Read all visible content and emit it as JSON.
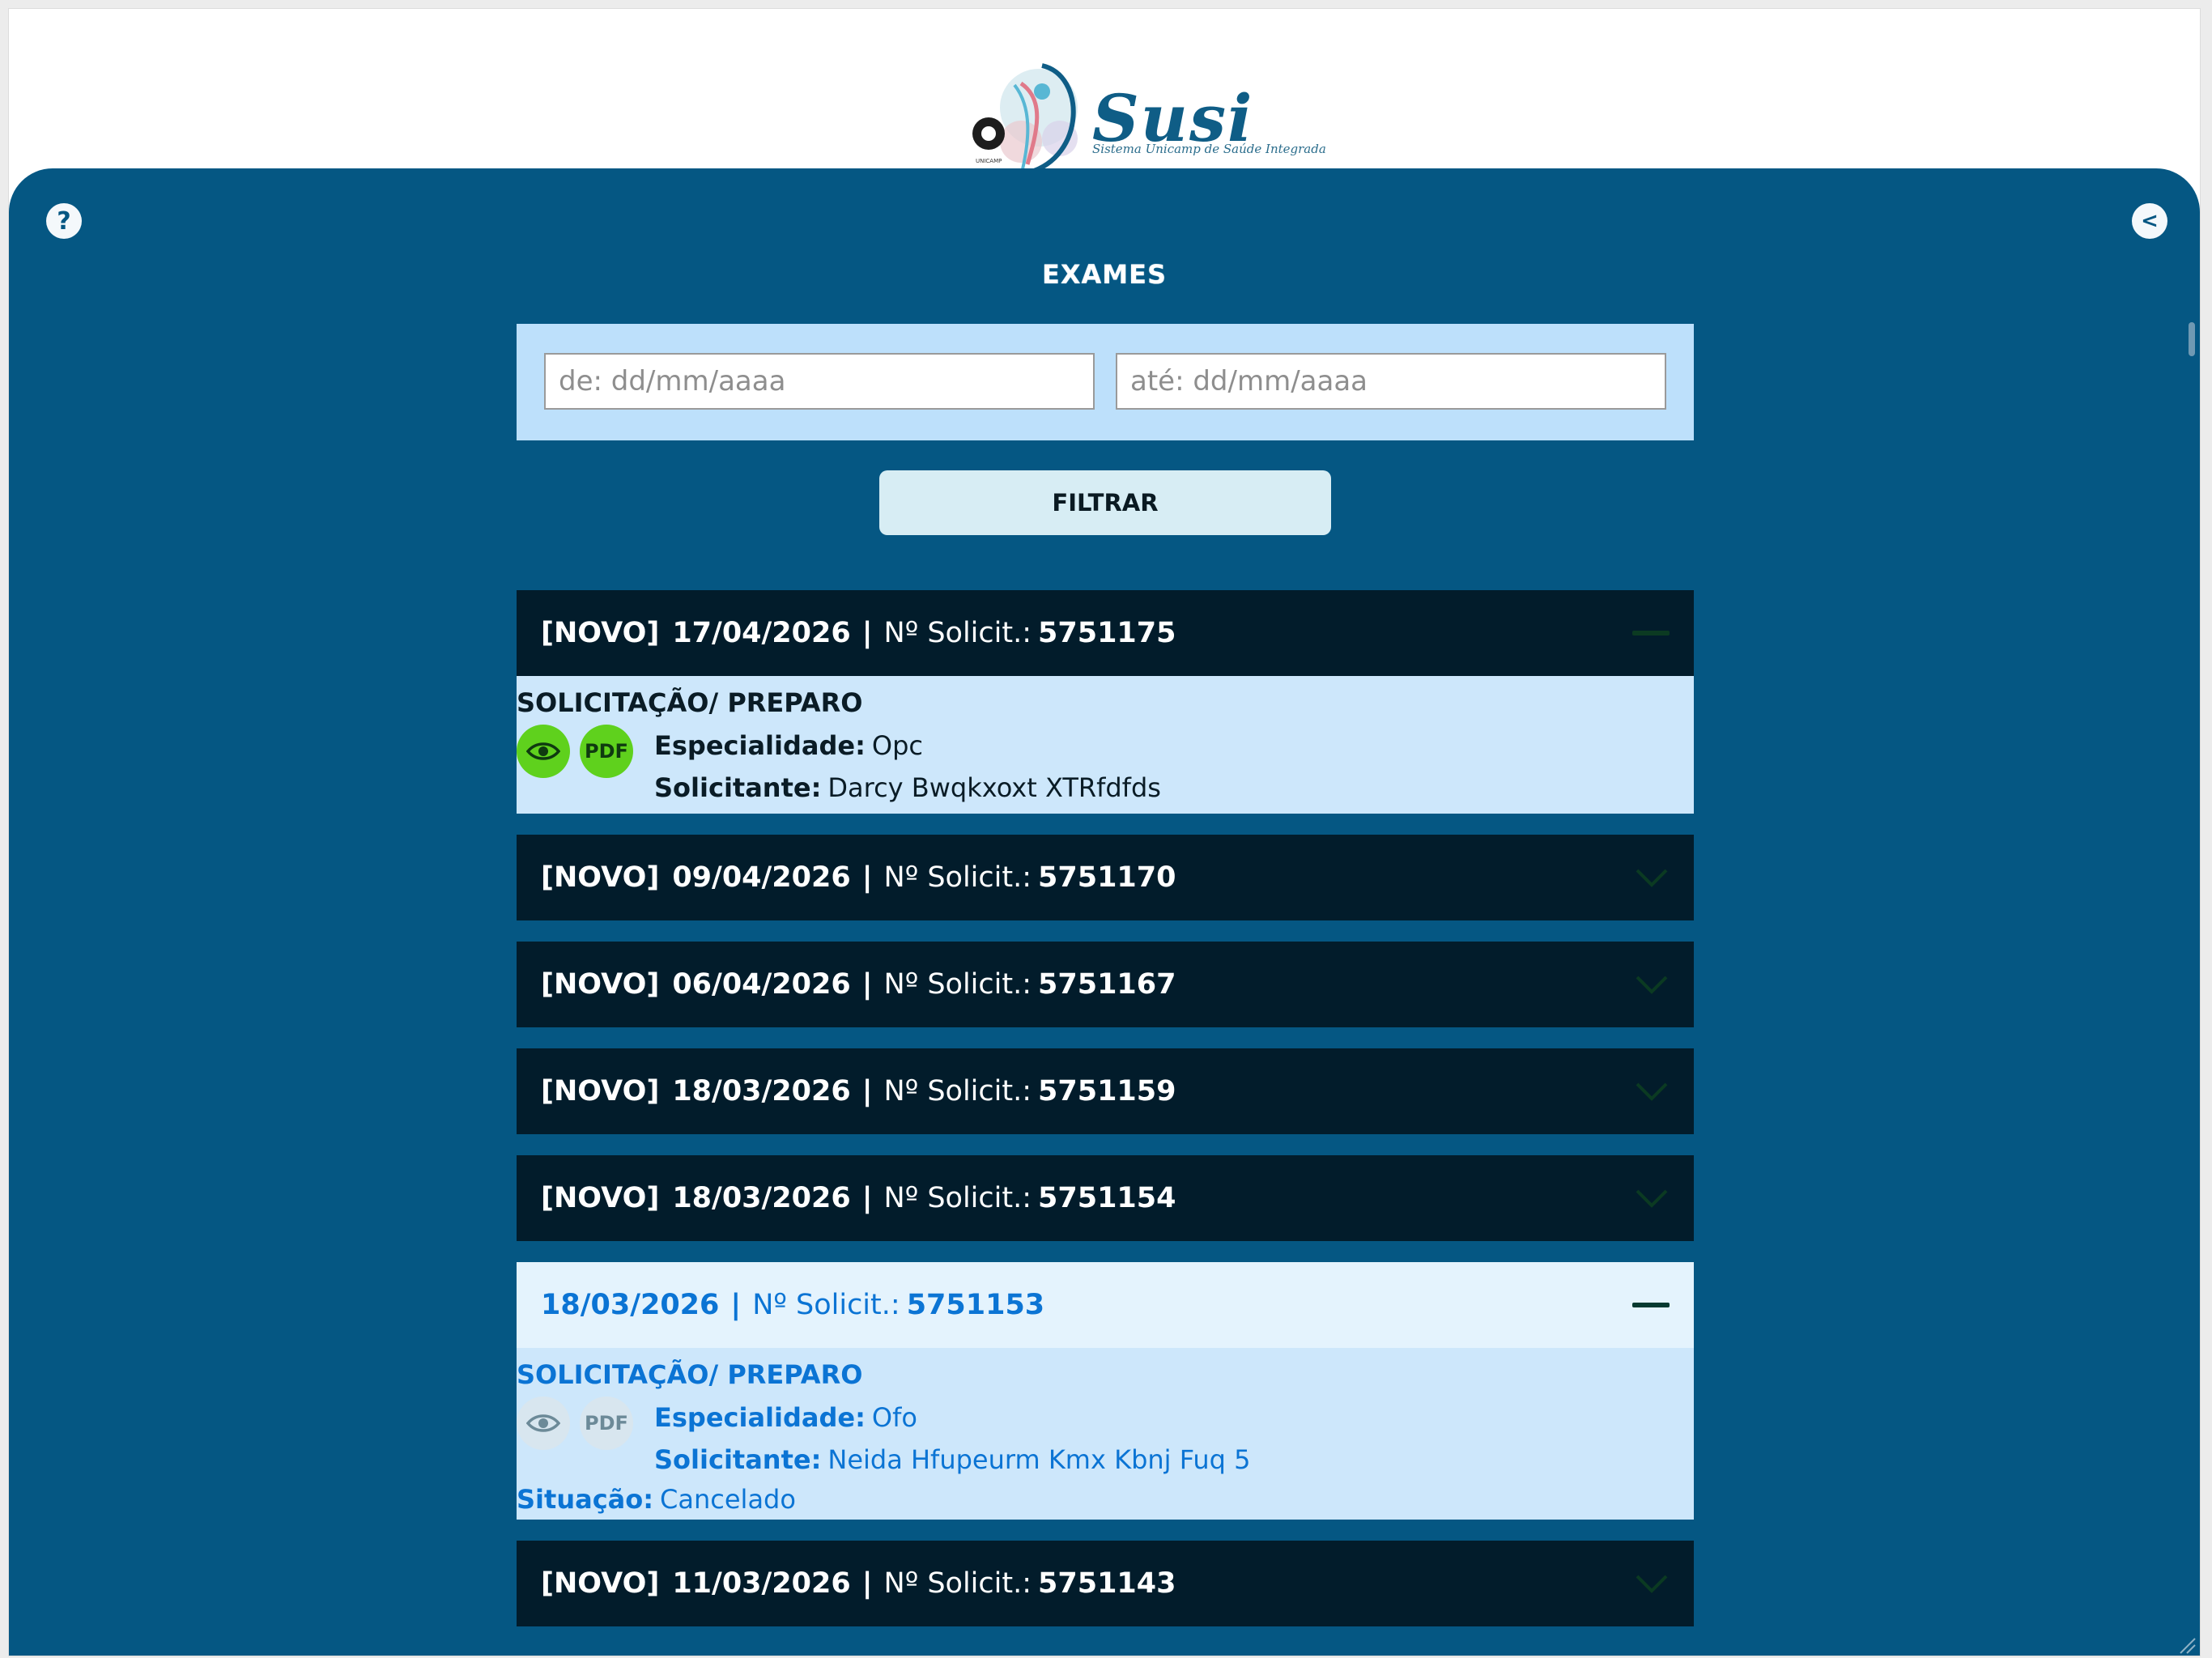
{
  "logo": {
    "brand": "Susi",
    "subtitle": "Sistema Unicamp de Saúde Integrada",
    "univ": "UNICAMP"
  },
  "toolbar": {
    "help_label": "?",
    "back_label": "<"
  },
  "page": {
    "title": "EXAMES"
  },
  "filter": {
    "from_placeholder": "de: dd/mm/aaaa",
    "to_placeholder": "até: dd/mm/aaaa",
    "button_label": "FILTRAR"
  },
  "labels": {
    "solicit": "Nº Solicit.:",
    "section": "SOLICITAÇÃO/ PREPARO",
    "especialidade": "Especialidade:",
    "solicitante": "Solicitante:",
    "situacao": "Situação:",
    "pdf": "PDF"
  },
  "exams": [
    {
      "tag": "[NOVO]",
      "date": "17/04/2026",
      "number": "5751175",
      "expanded": true,
      "especialidade": "Opc",
      "solicitante": "Darcy Bwqkxoxt XTRfdfds"
    },
    {
      "tag": "[NOVO]",
      "date": "09/04/2026",
      "number": "5751170"
    },
    {
      "tag": "[NOVO]",
      "date": "06/04/2026",
      "number": "5751167"
    },
    {
      "tag": "[NOVO]",
      "date": "18/03/2026",
      "number": "5751159"
    },
    {
      "tag": "[NOVO]",
      "date": "18/03/2026",
      "number": "5751154"
    },
    {
      "tag": "",
      "date": "18/03/2026",
      "number": "5751153",
      "expanded": true,
      "especialidade": "Ofo",
      "solicitante": "Neida Hfupeurm Kmx Kbnj Fuq 5",
      "situacao": "Cancelado"
    },
    {
      "tag": "[NOVO]",
      "date": "11/03/2026",
      "number": "5751143"
    }
  ],
  "colors": {
    "panel": "#055783",
    "header_dark": "#021c2b",
    "detail_bg": "#cde7fb",
    "accent_blue": "#0b74d4",
    "icon_green": "#5fd11d"
  }
}
